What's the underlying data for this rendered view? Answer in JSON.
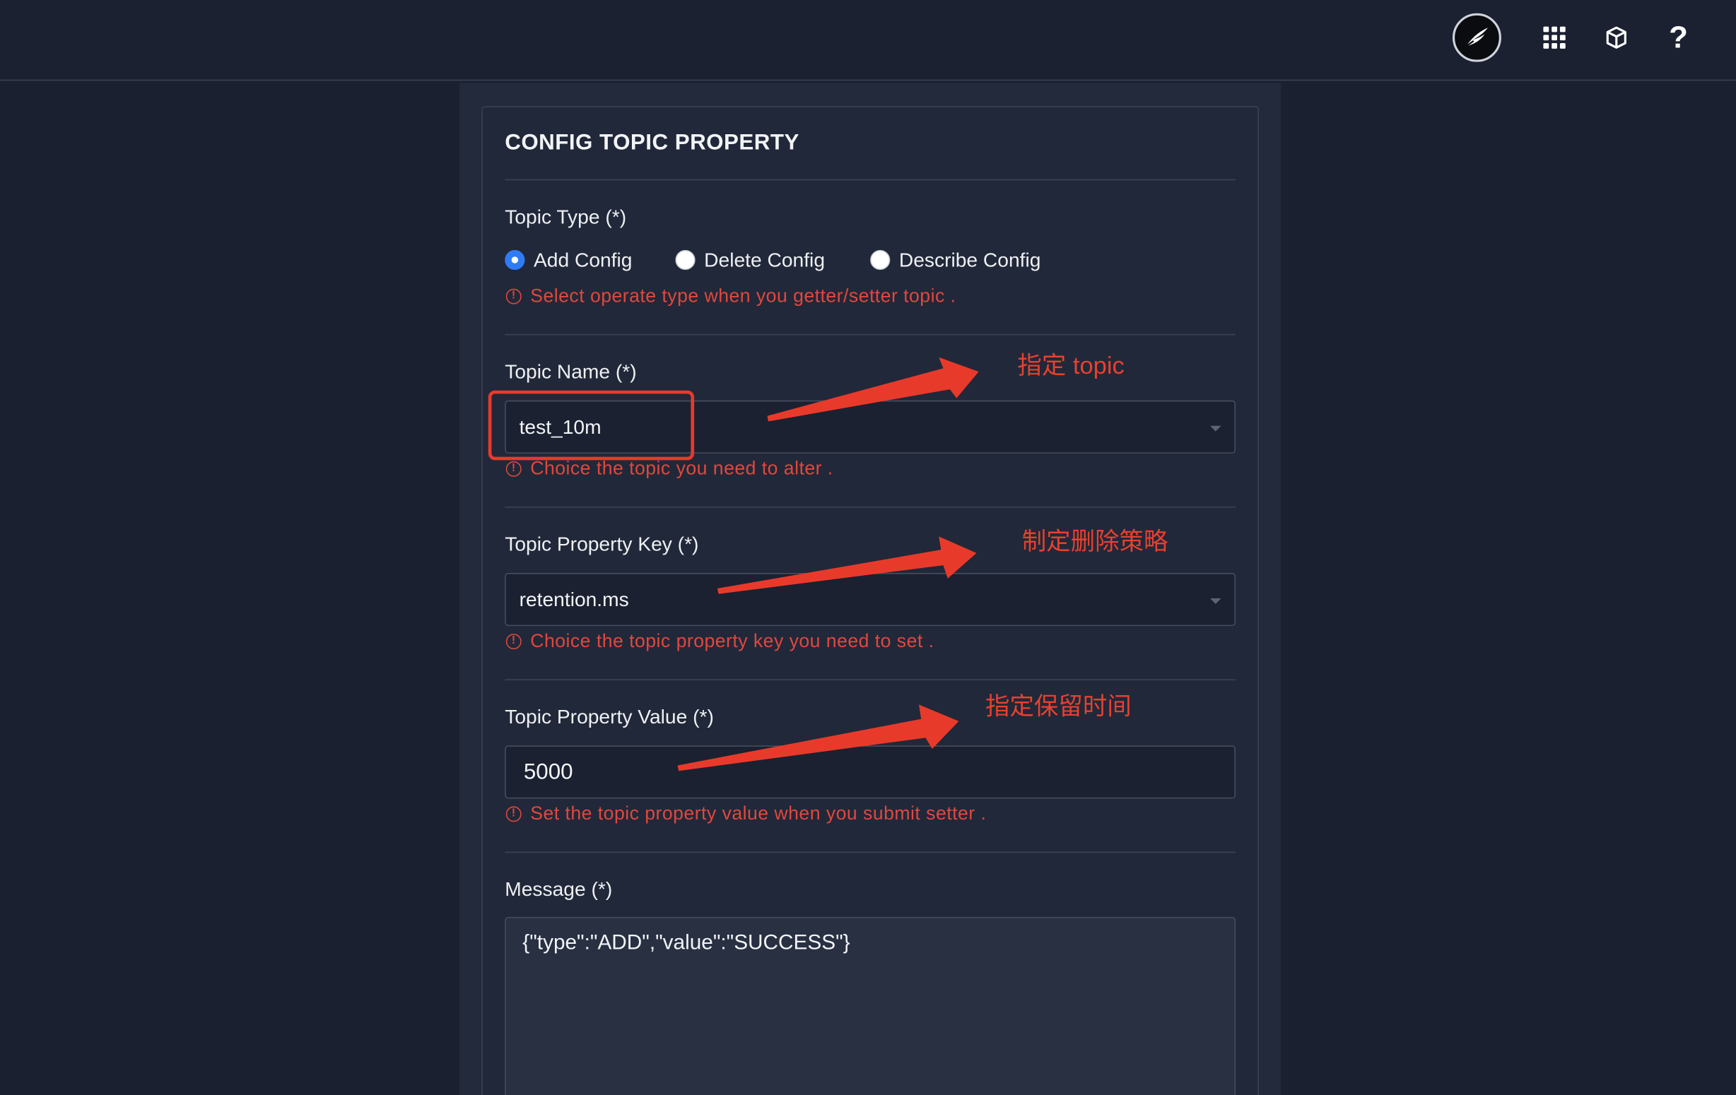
{
  "topbar": {
    "icons": [
      "feather-logo-icon",
      "apps-grid-icon",
      "cube-icon",
      "help-icon"
    ],
    "help_label": "?"
  },
  "form": {
    "title": "CONFIG TOPIC PROPERTY",
    "topic_type": {
      "label": "Topic Type (*)",
      "options": [
        "Add Config",
        "Delete Config",
        "Describe Config"
      ],
      "selected": "Add Config",
      "hint": "Select operate type when you getter/setter topic ."
    },
    "topic_name": {
      "label": "Topic Name (*)",
      "value": "test_10m",
      "hint": "Choice the topic you need to alter ."
    },
    "property_key": {
      "label": "Topic Property Key (*)",
      "value": "retention.ms",
      "hint": "Choice the topic property key you need to set ."
    },
    "property_value": {
      "label": "Topic Property Value (*)",
      "value": "5000",
      "hint": "Set the topic property value when you submit setter ."
    },
    "message": {
      "label": "Message (*)",
      "value": "{\"type\":\"ADD\",\"value\":\"SUCCESS\"}"
    }
  },
  "annotations": {
    "topic": "指定 topic",
    "delete_policy": "制定删除策略",
    "retention_time": "指定保留时间"
  },
  "colors": {
    "background": "#1a2030",
    "card": "#212839",
    "field": "#1b2130",
    "hint_red": "#e2473d",
    "annotation_red": "#e83a2b",
    "radio_blue": "#2f7bf5"
  }
}
